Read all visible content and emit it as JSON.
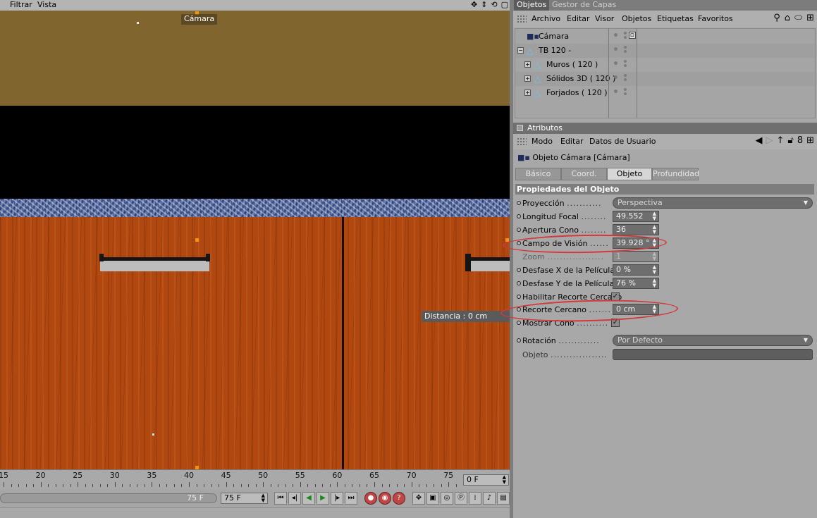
{
  "viewport": {
    "menu": [
      "Filtrar",
      "Vista"
    ],
    "icons": [
      "move-icon",
      "scale-icon",
      "rotate-icon",
      "maximize-icon"
    ],
    "camera_label": "Cámara",
    "distance_label": "Distancia : 0 cm"
  },
  "timeline": {
    "ticks": [
      "15",
      "20",
      "25",
      "30",
      "35",
      "40",
      "45",
      "50",
      "55",
      "60",
      "65",
      "70",
      "75"
    ],
    "current_frame": "0 F",
    "range_end_label": "75 F",
    "end_frame": "75 F"
  },
  "object_manager": {
    "tabs": [
      "Objetos",
      "Gestor de Capas"
    ],
    "menu": [
      "Archivo",
      "Editar",
      "Visor",
      "Objetos",
      "Etiquetas",
      "Favoritos"
    ],
    "objects": [
      {
        "name": "Cámara",
        "icon": "camera-icon"
      },
      {
        "name": "TB 120 -",
        "icon": "null-object-icon"
      },
      {
        "name": "Muros ( 120 )",
        "icon": "null-object-icon"
      },
      {
        "name": "Sólidos 3D ( 120 )",
        "icon": "null-object-icon"
      },
      {
        "name": "Forjados ( 120 )",
        "icon": "null-object-icon"
      }
    ]
  },
  "attributes": {
    "header": "Atributos",
    "menu": [
      "Modo",
      "Editar",
      "Datos de Usuario"
    ],
    "object_title": "Objeto Cámara [Cámara]",
    "tabs": [
      "Básico",
      "Coord.",
      "Objeto",
      "Profundidad"
    ],
    "active_tab": "Objeto",
    "section_title": "Propiedades del Objeto",
    "props": {
      "proyeccion": {
        "label": "Proyección",
        "value": "Perspectiva"
      },
      "longitud_focal": {
        "label": "Longitud Focal",
        "value": "49.552"
      },
      "apertura_cono": {
        "label": "Apertura Cono",
        "value": "36"
      },
      "campo_vision": {
        "label": "Campo de Visión",
        "value": "39.928 °"
      },
      "zoom": {
        "label": "Zoom",
        "value": "1"
      },
      "desfase_x": {
        "label": "Desfase X de la Película",
        "value": "0 %"
      },
      "desfase_y": {
        "label": "Desfase Y de la Película",
        "value": "76 %"
      },
      "habilitar_recorte": {
        "label": "Habilitar Recorte Cercano",
        "checked": true
      },
      "recorte_cercano": {
        "label": "Recorte Cercano",
        "value": "0 cm"
      },
      "mostrar_cono": {
        "label": "Mostrar Cono",
        "checked": true
      },
      "rotacion": {
        "label": "Rotación",
        "value": "Por Defecto"
      },
      "objeto": {
        "label": "Objeto"
      }
    }
  },
  "colors": {
    "annotation": "#d23a3a",
    "ceiling": "#80652f",
    "wood": "#b0480f",
    "selected_tab": "#5b5b5b"
  }
}
